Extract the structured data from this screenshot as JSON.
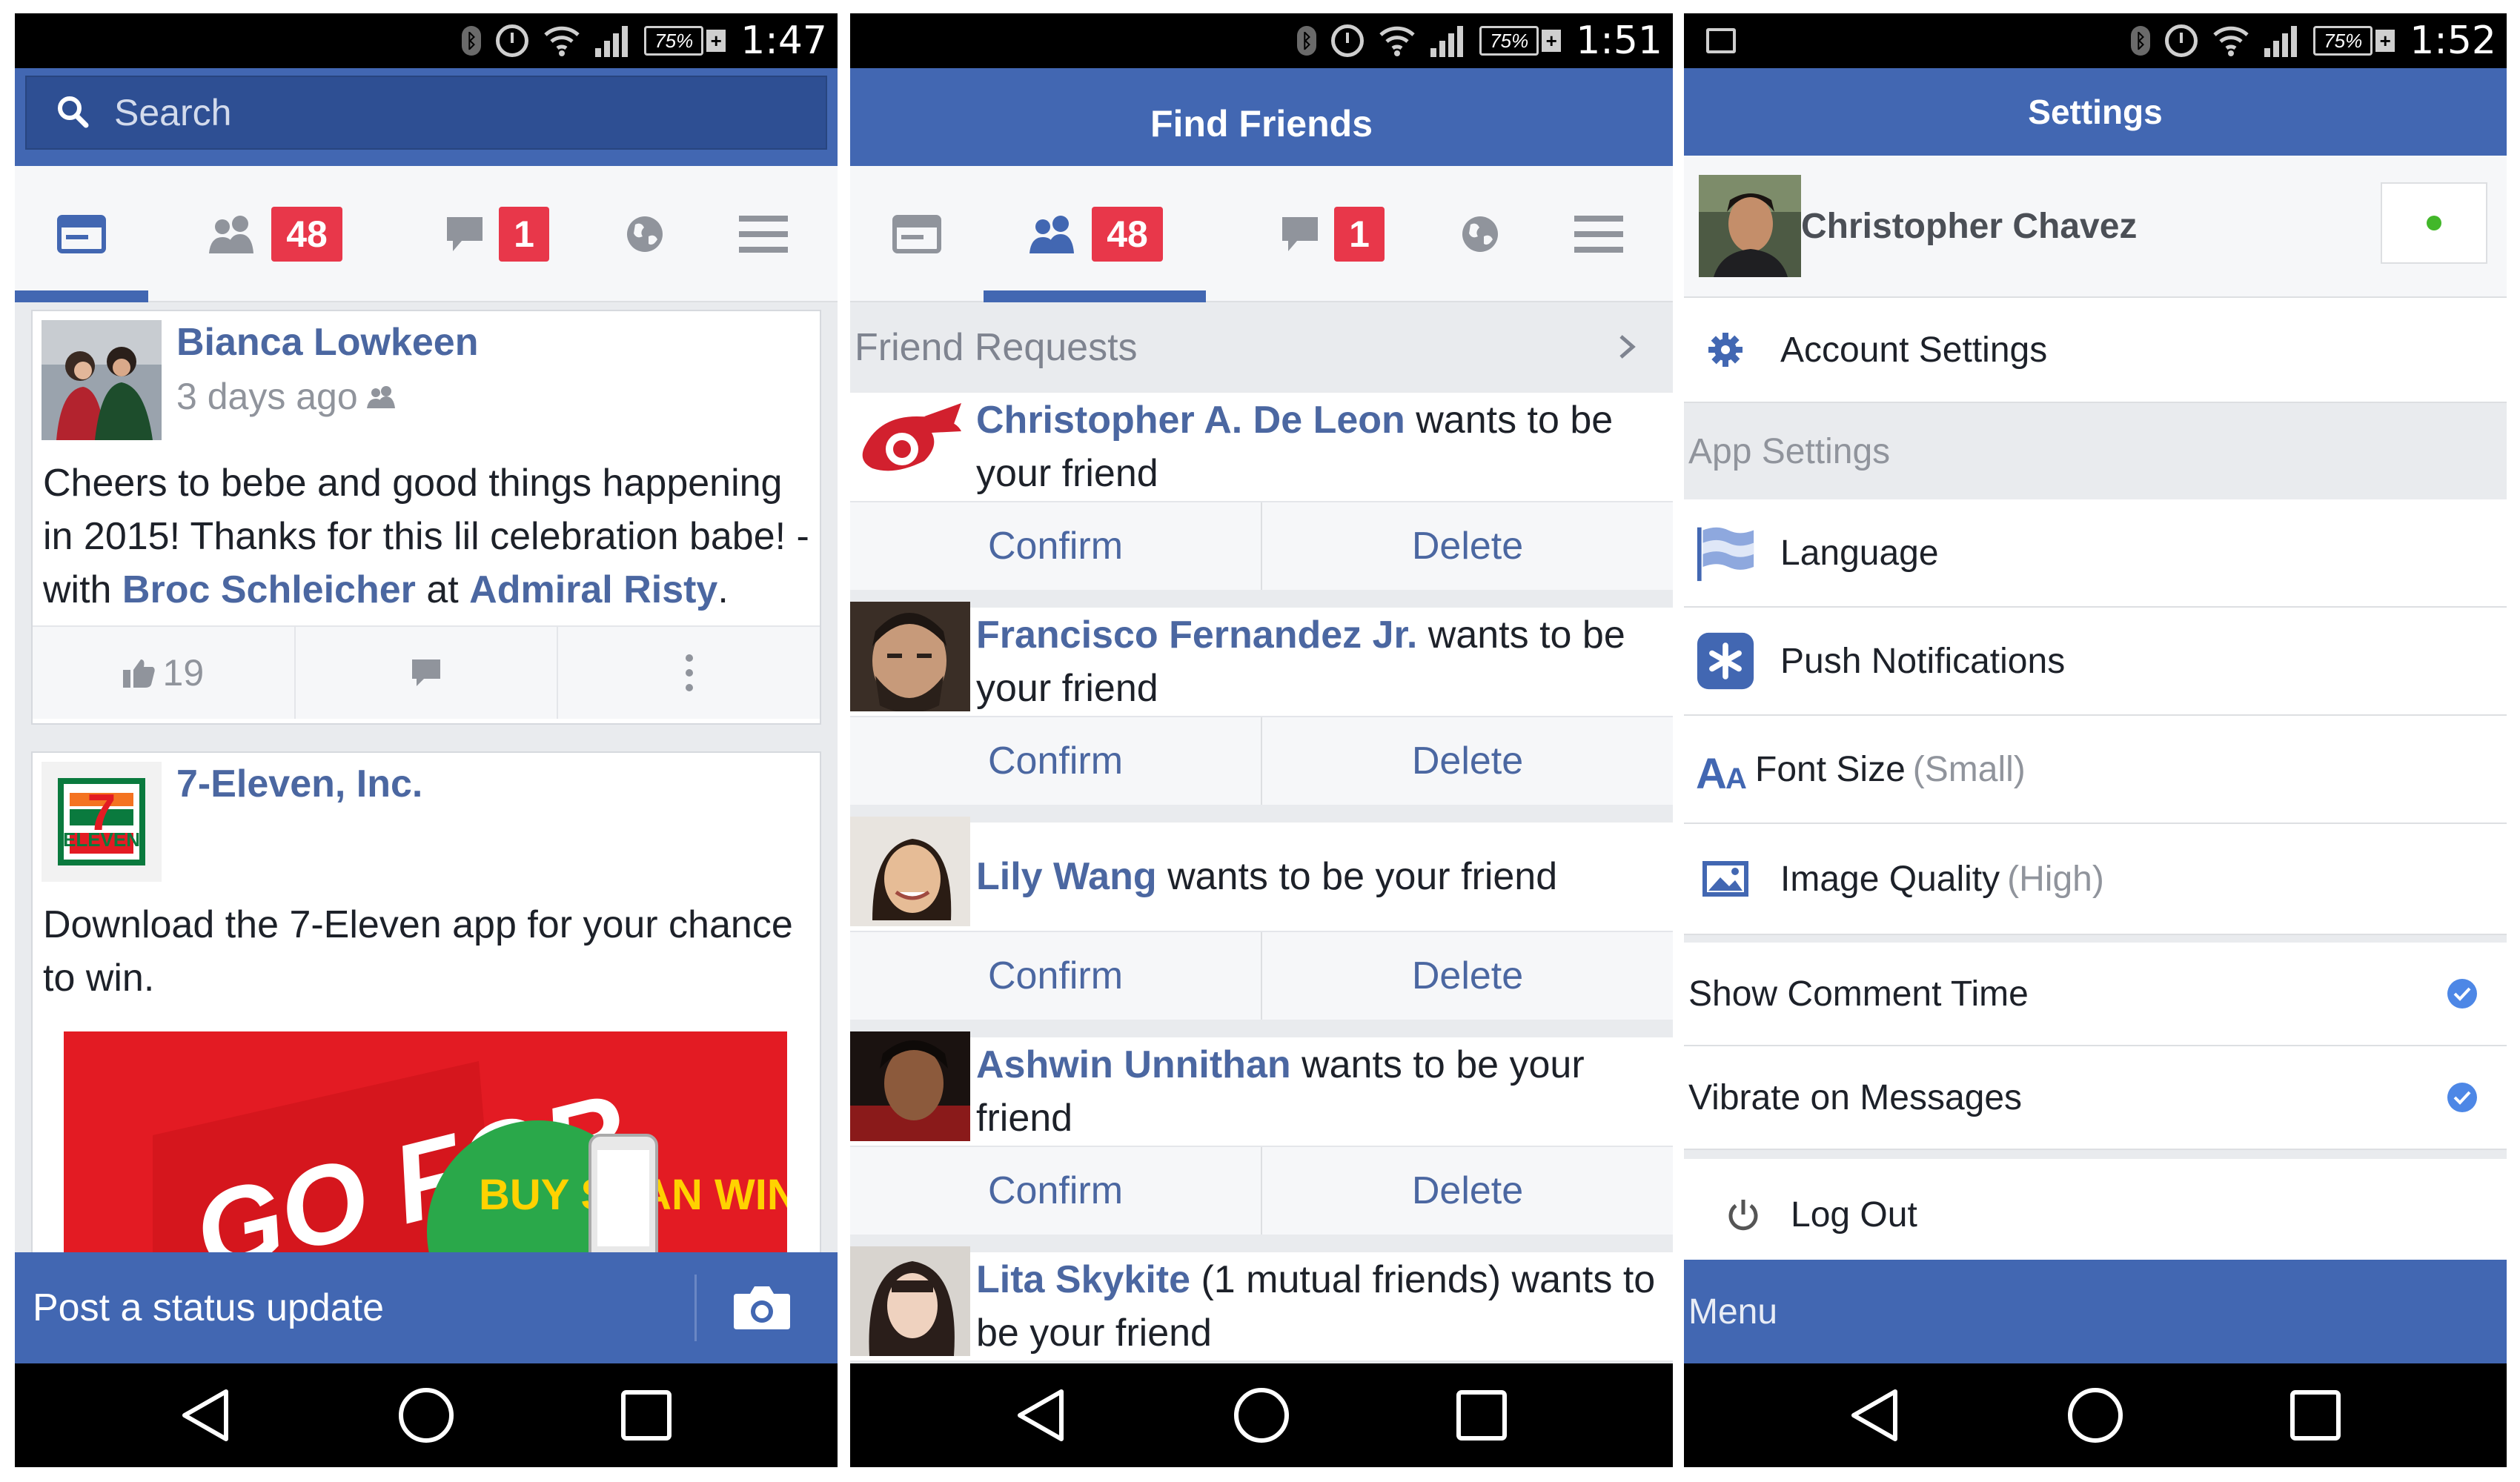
{
  "colors": {
    "brand_blue": "#4267b2",
    "badge_red": "#e8374a",
    "link_blue": "#4b67a1",
    "check_blue": "#4d87e6"
  },
  "panels": [
    {
      "status": {
        "battery": "75%",
        "time": "1:47"
      },
      "search": {
        "label": "Search"
      },
      "tabs": {
        "friend_badge": "48",
        "message_badge": "1"
      },
      "posts": [
        {
          "author": "Bianca Lowkeen",
          "time": "3 days ago",
          "text_1": "Cheers to bebe and good things happening in 2015! Thanks for this lil celebration babe! - with ",
          "tag_person": "Broc Schleicher",
          "text_at": " at ",
          "tag_place": "Admiral Risty",
          "text_end": ".",
          "likes": "19"
        },
        {
          "author": "7-Eleven, Inc.",
          "text": "Download the 7-Eleven app for your chance to win.",
          "logo_text": "ELEVEN",
          "logo_number": "7",
          "ad_text_big": "GO FOR",
          "ad_text_bubble": "BUY SCAN WIN"
        }
      ],
      "post_status": {
        "label": "Post a status update"
      }
    },
    {
      "status": {
        "battery": "75%",
        "time": "1:51"
      },
      "title": "Find Friends",
      "tabs": {
        "friend_badge": "48",
        "message_badge": "1"
      },
      "section": "Friend Requests",
      "requests": [
        {
          "name": "Christopher A. De Leon",
          "suffix": " wants to be your friend",
          "confirm": "Confirm",
          "delete": "Delete"
        },
        {
          "name": "Francisco Fernandez Jr.",
          "suffix": " wants to be your friend",
          "confirm": "Confirm",
          "delete": "Delete"
        },
        {
          "name": "Lily Wang",
          "suffix": " wants to be your friend",
          "confirm": "Confirm",
          "delete": "Delete"
        },
        {
          "name": "Ashwin Unnithan",
          "suffix": " wants to be your friend",
          "confirm": "Confirm",
          "delete": "Delete"
        },
        {
          "name": "Lita Skykite",
          "suffix": " (1 mutual friends) wants to be your friend"
        }
      ]
    },
    {
      "status": {
        "battery": "75%",
        "time": "1:52"
      },
      "title": "Settings",
      "profile_name": "Christopher Chavez",
      "account_settings": "Account Settings",
      "app_settings_header": "App Settings",
      "language": "Language",
      "push_notifications": "Push Notifications",
      "font_size": "Font Size",
      "font_size_value": "(Small)",
      "image_quality": "Image Quality",
      "image_quality_value": "(High)",
      "show_comment_time": "Show Comment Time",
      "vibrate_on_messages": "Vibrate on Messages",
      "log_out": "Log Out",
      "menu": "Menu"
    }
  ]
}
